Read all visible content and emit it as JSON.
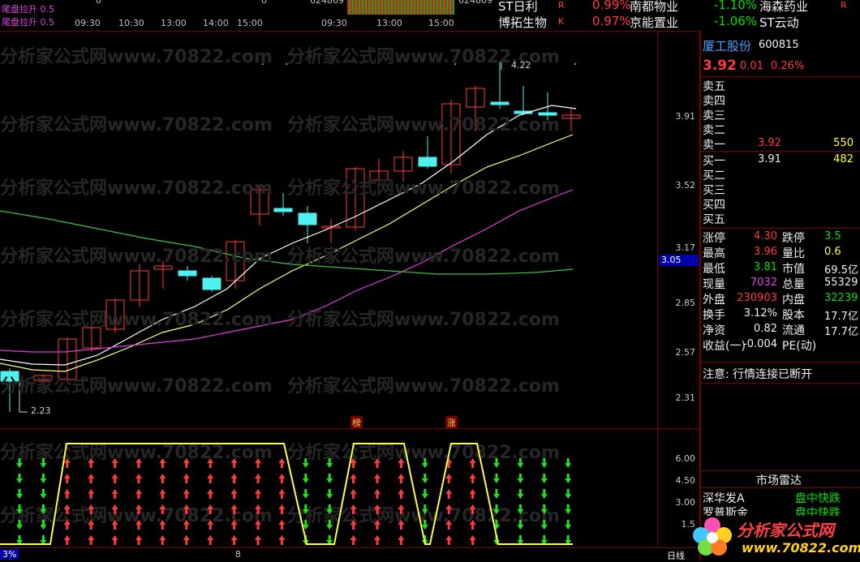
{
  "top_strip": {
    "indicator_1": "尾盘拉升 0.5",
    "indicator_2": "尾盘拉升 0.5",
    "mini_times_a": [
      "09:30",
      "10:30",
      "13:00",
      "14:00",
      "15:00"
    ],
    "mini_times_b": [
      "09:30",
      "13:00",
      "15:00"
    ],
    "mini_num_1": "624869",
    "mini_num_2": "624869",
    "zero_1": "0",
    "zero_2": "0"
  },
  "top_rankings": [
    {
      "name": "ST日利",
      "pct": "0.99%",
      "tag": "R"
    },
    {
      "name": "博拓生物",
      "pct": "0.97%",
      "tag": "K"
    },
    {
      "name": "南都物业",
      "pct": "",
      "tag": ""
    },
    {
      "name": "京能置业",
      "pct": "",
      "tag": ""
    },
    {
      "name": "海森药业",
      "pct": "-1.10%",
      "tag": "R"
    },
    {
      "name": "ST云动",
      "pct": "-1.06%",
      "tag": ""
    }
  ],
  "watermark": "分析家公式网www.70822.com",
  "main_chart": {
    "price_ticks": [
      "3.91",
      "3.52",
      "3.17",
      "2.85",
      "2.57",
      "2.31"
    ],
    "current_price_marker": "3.05",
    "high_label": "4.22",
    "low_label": "2.23",
    "markers": [
      "榜",
      "涨"
    ]
  },
  "sub_chart": {
    "ticks": [
      "6.00",
      "4.50",
      "3.00",
      "1.5"
    ],
    "arrows": [
      {
        "dir": "down",
        "count": 6
      },
      {
        "dir": "down",
        "count": 6
      },
      {
        "dir": "up",
        "count": 6
      },
      {
        "dir": "up",
        "count": 6
      },
      {
        "dir": "up",
        "count": 6
      },
      {
        "dir": "up",
        "count": 6
      },
      {
        "dir": "up",
        "count": 6
      },
      {
        "dir": "up",
        "count": 6
      },
      {
        "dir": "up",
        "count": 6
      },
      {
        "dir": "up",
        "count": 6
      },
      {
        "dir": "up",
        "count": 6
      },
      {
        "dir": "up",
        "count": 6
      },
      {
        "dir": "down",
        "count": 6
      },
      {
        "dir": "down",
        "count": 6
      },
      {
        "dir": "up",
        "count": 6
      },
      {
        "dir": "up",
        "count": 6
      },
      {
        "dir": "up",
        "count": 6
      },
      {
        "dir": "down",
        "count": 6
      },
      {
        "dir": "up",
        "count": 6
      },
      {
        "dir": "up",
        "count": 6
      },
      {
        "dir": "down",
        "count": 6
      },
      {
        "dir": "down",
        "count": 6
      },
      {
        "dir": "down",
        "count": 6
      },
      {
        "dir": "down",
        "count": 6
      }
    ]
  },
  "bottom_bar": {
    "left": "3%",
    "mid": "8",
    "right": "日线"
  },
  "quote_panel": {
    "stock_name": "厦工股份",
    "stock_code": "600815",
    "price": "3.92",
    "change": "0.01",
    "change_pct": "0.26%",
    "asks": [
      {
        "label": "卖五",
        "price": "",
        "vol": ""
      },
      {
        "label": "卖四",
        "price": "",
        "vol": ""
      },
      {
        "label": "卖三",
        "price": "",
        "vol": ""
      },
      {
        "label": "卖二",
        "price": "",
        "vol": ""
      },
      {
        "label": "卖一",
        "price": "3.92",
        "vol": "550"
      }
    ],
    "bids": [
      {
        "label": "买一",
        "price": "3.91",
        "vol": "482"
      },
      {
        "label": "买二",
        "price": "",
        "vol": ""
      },
      {
        "label": "买三",
        "price": "",
        "vol": ""
      },
      {
        "label": "买四",
        "price": "",
        "vol": ""
      },
      {
        "label": "买五",
        "price": "",
        "vol": ""
      }
    ],
    "stats": [
      {
        "l1": "涨停",
        "v1": "4.30",
        "c1": "red",
        "l2": "跌停",
        "v2": "3.5",
        "c2": "green"
      },
      {
        "l1": "最高",
        "v1": "3.96",
        "c1": "red",
        "l2": "量比",
        "v2": "0.6",
        "c2": "yellow"
      },
      {
        "l1": "最低",
        "v1": "3.81",
        "c1": "green",
        "l2": "市值",
        "v2": "69.5亿",
        "c2": "white"
      },
      {
        "l1": "现量",
        "v1": "7032",
        "c1": "magenta",
        "l2": "总量",
        "v2": "55329",
        "c2": "white"
      },
      {
        "l1": "外盘",
        "v1": "230903",
        "c1": "red",
        "l2": "内盘",
        "v2": "32239",
        "c2": "green"
      },
      {
        "l1": "换手",
        "v1": "3.12%",
        "c1": "white",
        "l2": "股本",
        "v2": "17.7亿",
        "c2": "white"
      },
      {
        "l1": "净资",
        "v1": "0.82",
        "c1": "white",
        "l2": "流通",
        "v2": "17.7亿",
        "c2": "white"
      },
      {
        "l1": "收益(一)",
        "v1": "-0.004",
        "c1": "white",
        "l2": "PE(动)",
        "v2": "",
        "c2": "white"
      }
    ],
    "notice": "注意: 行情连接已断开",
    "radar_title": "市场雷达",
    "radar_items": [
      {
        "name": "深华发A",
        "status": "盘中快跌"
      },
      {
        "name": "罗普斯金",
        "status": "盘中快跌"
      }
    ],
    "logo_text": "分析家公式网",
    "logo_url": "www.70822.com"
  },
  "colors": {
    "up": "#ff3a3a",
    "down": "#4ff0f0",
    "ma5": "#ffffff",
    "ma10": "#ffff80",
    "ma20": "#e040e0",
    "ma60": "#40c040",
    "sub_line": "#ffff40"
  }
}
